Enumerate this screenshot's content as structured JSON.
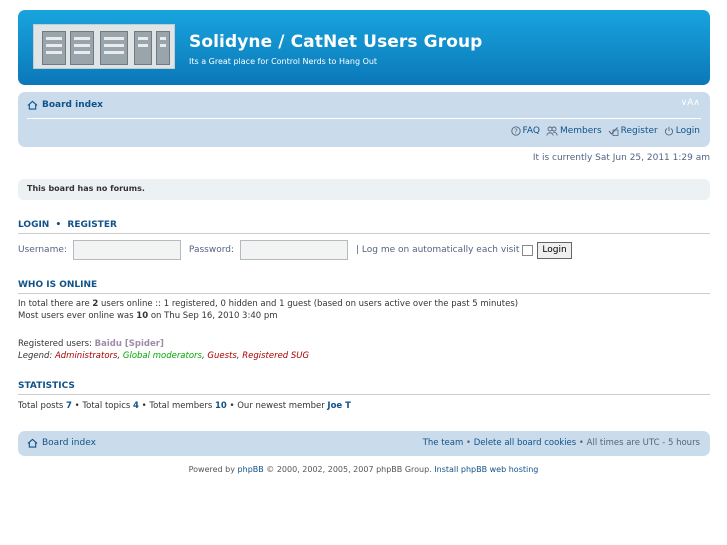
{
  "header": {
    "title": "Solidyne / CatNet Users Group",
    "description": "Its a Great place for Control Nerds to Hang Out",
    "gradient_top": "#18a4de",
    "gradient_bottom": "#0b78b8"
  },
  "navbar": {
    "breadcrumb": "Board index",
    "font_resize": "∨A∧",
    "links": {
      "faq": "FAQ",
      "members": "Members",
      "register": "Register",
      "login": "Login"
    }
  },
  "date_text": "It is currently Sat Jun 25, 2011 1:29 am",
  "no_forums": "This board has no forums.",
  "login": {
    "heading_login": "Login",
    "heading_sep": "•",
    "heading_register": "Register",
    "username_label": "Username:",
    "password_label": "Password:",
    "autologin_label": "| Log me on automatically each visit",
    "button": "Login"
  },
  "online": {
    "heading": "Who is online",
    "line1_a": "In total there are ",
    "line1_count": "2",
    "line1_b": " users online :: 1 registered, 0 hidden and 1 guest (based on users active over the past 5 minutes)",
    "line2_a": "Most users ever online was ",
    "line2_count": "10",
    "line2_b": " on Thu Sep 16, 2010 3:40 pm",
    "registered_label": "Registered users: ",
    "registered_users": "Baidu [Spider]",
    "legend_label": "Legend: ",
    "legend": {
      "admins": "Administrators",
      "gmods": "Global moderators",
      "guests": "Guests",
      "sug": "Registered SUG"
    }
  },
  "stats": {
    "heading": "Statistics",
    "posts_label": "Total posts ",
    "posts": "7",
    "topics_label": " • Total topics ",
    "topics": "4",
    "members_label": " • Total members ",
    "members": "10",
    "newest_label": " • Our newest member ",
    "newest": "Joe T"
  },
  "footer": {
    "breadcrumb": "Board index",
    "team": "The team",
    "sep": " • ",
    "delete_cookies": "Delete all board cookies",
    "times": " • All times are UTC - 5 hours"
  },
  "powered": {
    "prefix": "Powered by ",
    "phpbb": "phpBB",
    "middle": " © 2000, 2002, 2005, 2007 phpBB Group. ",
    "install": "Install phpBB web hosting"
  },
  "colors": {
    "link": "#105289",
    "nav_bg": "#cadceb",
    "admin": "#aa0000",
    "gmod": "#00aa00"
  }
}
